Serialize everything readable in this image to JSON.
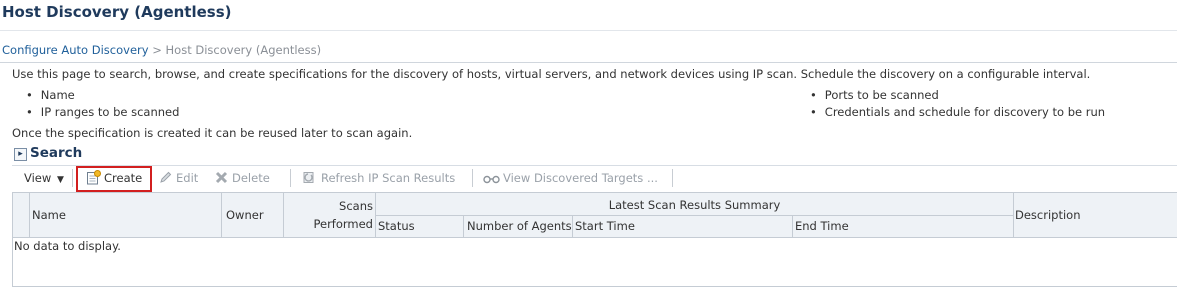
{
  "page": {
    "title": "Host Discovery (Agentless)",
    "breadcrumb": {
      "link": "Configure Auto Discovery",
      "separator": ">",
      "current": "Host Discovery (Agentless)"
    },
    "description": "Use this page to search, browse, and create specifications for the discovery of hosts, virtual servers, and network devices using IP scan. Schedule the discovery on a configurable interval.",
    "bullets_left": [
      "Name",
      "IP ranges to be scanned"
    ],
    "bullets_right": [
      "Ports to be scanned",
      "Credentials and schedule for discovery to be run"
    ],
    "reuse_note": "Once the specification is created it can be reused later to scan again."
  },
  "search": {
    "header": "Search",
    "toolbar": {
      "view": "View",
      "create": "Create",
      "edit": "Edit",
      "delete": "Delete",
      "refresh": "Refresh IP Scan Results",
      "view_targets": "View Discovered Targets ..."
    },
    "table": {
      "columns": {
        "name": "Name",
        "owner": "Owner",
        "scans_performed_1": "Scans",
        "scans_performed_2": "Performed",
        "group": "Latest Scan Results Summary",
        "status": "Status",
        "agents": "Number of Agents",
        "start": "Start Time",
        "end": "End Time",
        "description": "Description"
      },
      "empty": "No data to display."
    }
  },
  "colors": {
    "title": "#1f3a5c",
    "link": "#1f5f9a",
    "highlight_border": "#d21f1f",
    "header_bg": "#eef2f6"
  }
}
